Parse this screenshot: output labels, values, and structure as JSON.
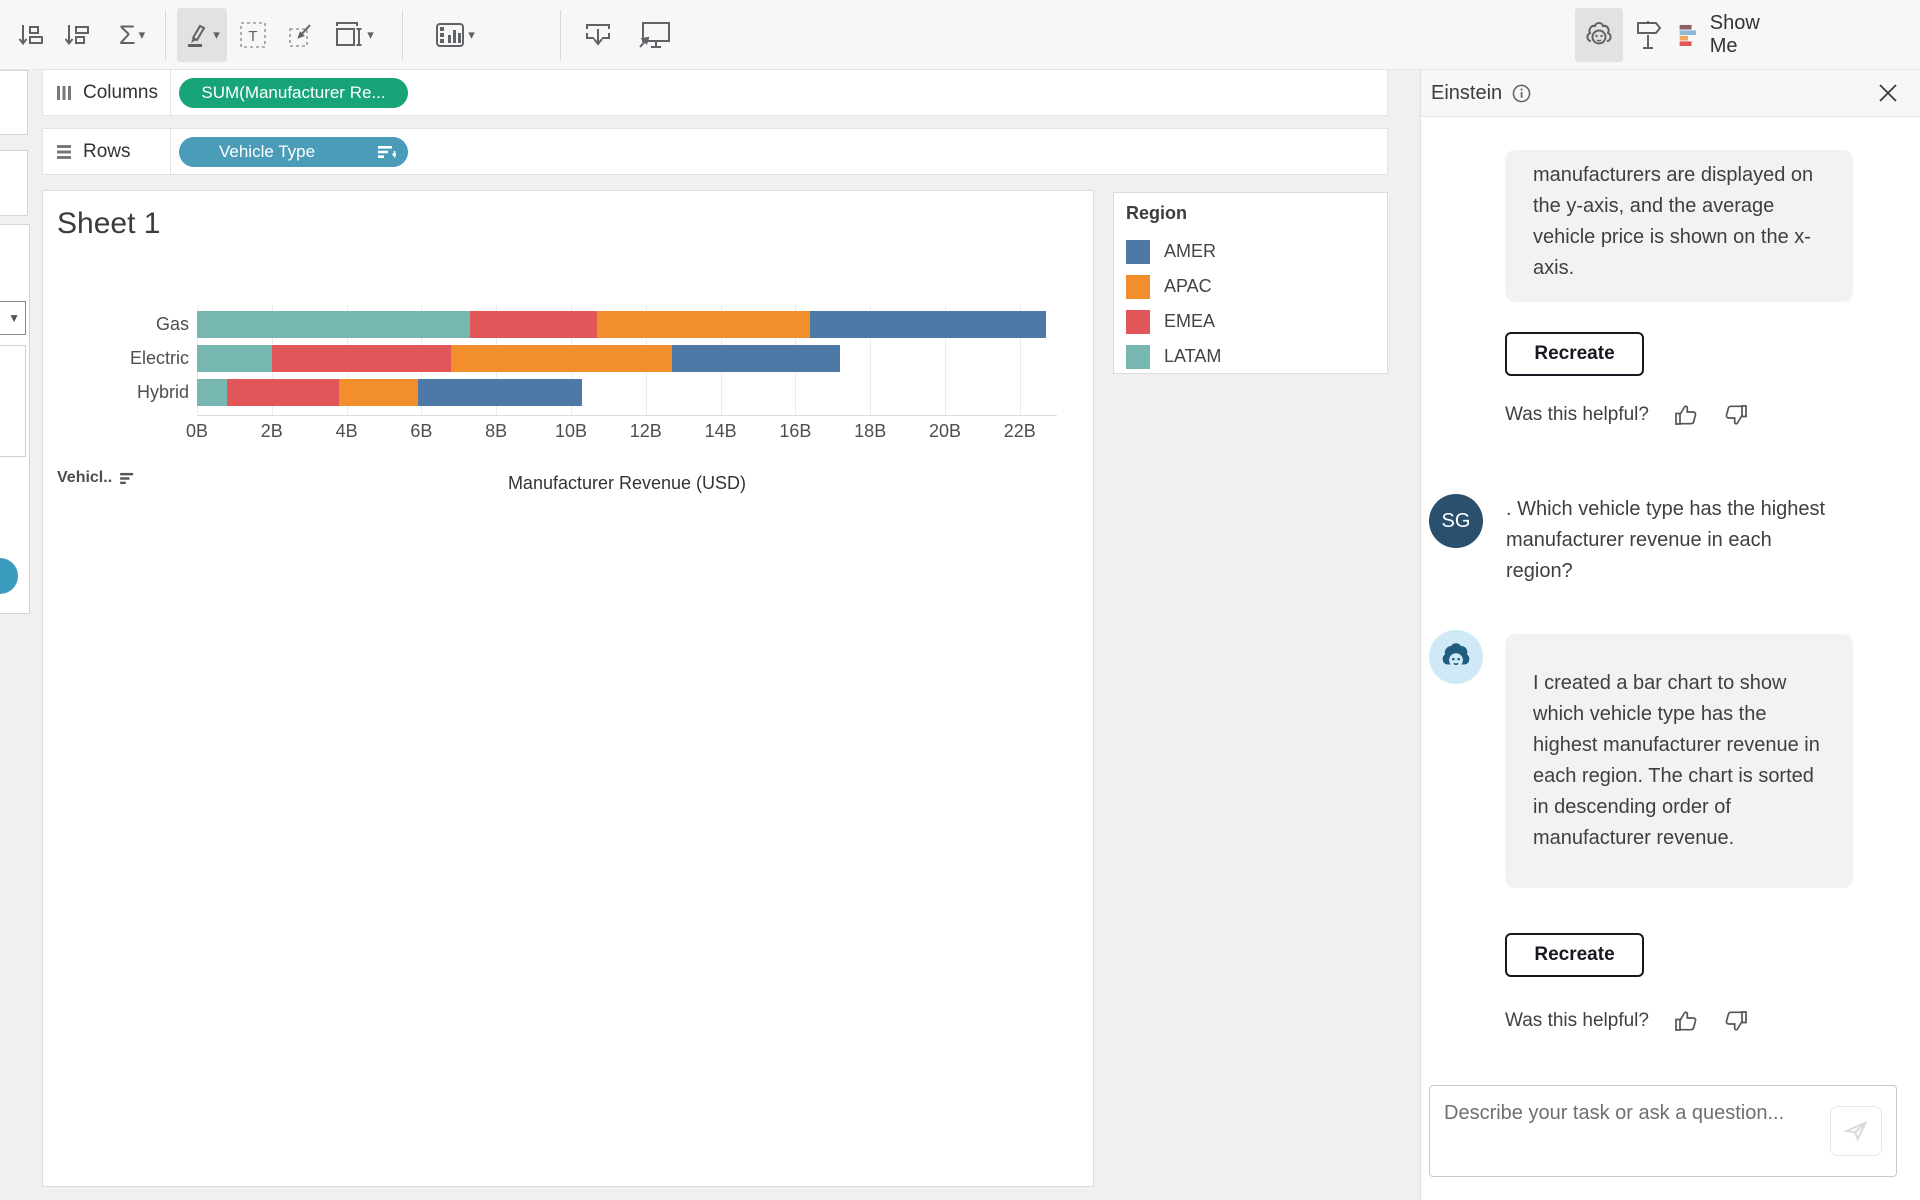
{
  "toolbar": {
    "show_me_label": "Show Me",
    "show_me_colors": [
      "#8a6266",
      "#8fb8d8",
      "#f2a45c",
      "#e05656"
    ]
  },
  "shelves": {
    "columns_label": "Columns",
    "columns_pill_label": "SUM(Manufacturer Re...",
    "rows_label": "Rows",
    "rows_pill_label": "Vehicle Type"
  },
  "sheet": {
    "title": "Sheet 1",
    "row_field_header": "Vehicl.."
  },
  "chart_data": {
    "type": "bar",
    "orientation": "horizontal",
    "stacked": true,
    "title": "Sheet 1",
    "categories": [
      "Gas",
      "Electric",
      "Hybrid"
    ],
    "series": [
      {
        "name": "LATAM",
        "color": "#76b7b2",
        "values": [
          7.3,
          2.0,
          0.8
        ]
      },
      {
        "name": "EMEA",
        "color": "#e15759",
        "values": [
          3.4,
          4.8,
          3.0
        ]
      },
      {
        "name": "APAC",
        "color": "#f28e2b",
        "values": [
          5.7,
          5.9,
          2.1
        ]
      },
      {
        "name": "AMER",
        "color": "#4e79a7",
        "values": [
          6.3,
          4.5,
          4.4
        ]
      }
    ],
    "totals": [
      22.7,
      17.2,
      10.3
    ],
    "units": "billions USD",
    "xlabel": "Manufacturer Revenue (USD)",
    "x_ticks": [
      "0B",
      "2B",
      "4B",
      "6B",
      "8B",
      "10B",
      "12B",
      "14B",
      "16B",
      "18B",
      "20B",
      "22B"
    ],
    "x_tick_values": [
      0,
      2,
      4,
      6,
      8,
      10,
      12,
      14,
      16,
      18,
      20,
      22
    ],
    "xlim": [
      0,
      23
    ],
    "grid": true,
    "legend": {
      "title": "Region",
      "position": "right",
      "items": [
        {
          "label": "AMER",
          "color": "#4e79a7"
        },
        {
          "label": "APAC",
          "color": "#f28e2b"
        },
        {
          "label": "EMEA",
          "color": "#e15759"
        },
        {
          "label": "LATAM",
          "color": "#76b7b2"
        }
      ]
    }
  },
  "einstein": {
    "title": "Einstein",
    "partial_message": "manufacturers are displayed on the y-axis, and the average vehicle price is shown on the x-axis.",
    "recreate_label": "Recreate",
    "helpful_label": "Was this helpful?",
    "user_initials": "SG",
    "user_message": ". Which vehicle type has the highest manufacturer revenue in each region?",
    "assistant_message": "I created a bar chart to show which vehicle type has the highest manufacturer revenue in each region. The chart is sorted in descending order of manufacturer revenue.",
    "input_placeholder": "Describe your task or ask a question..."
  }
}
